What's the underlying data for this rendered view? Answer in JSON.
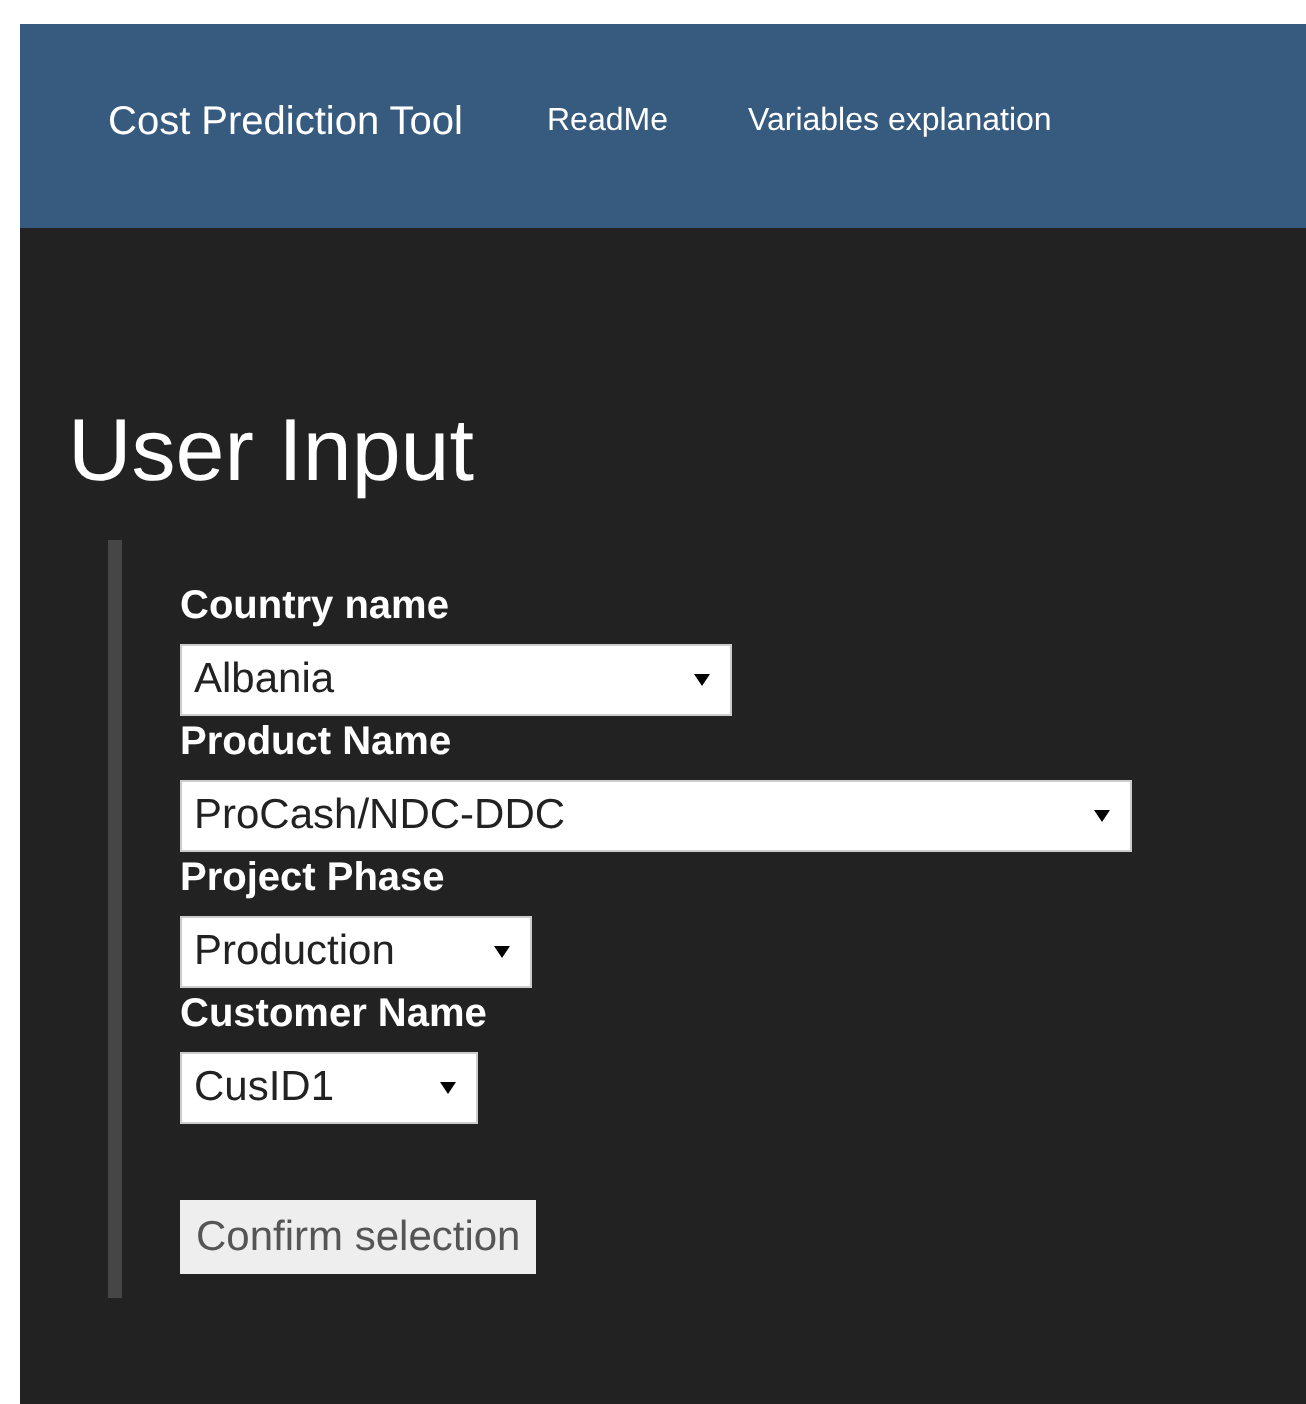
{
  "navbar": {
    "brand": "Cost Prediction Tool",
    "links": [
      {
        "label": "ReadMe"
      },
      {
        "label": "Variables explanation"
      }
    ]
  },
  "heading": "User Input",
  "fields": [
    {
      "label": "Country name",
      "value": "Albania"
    },
    {
      "label": "Product Name",
      "value": "ProCash/NDC-DDC"
    },
    {
      "label": "Project Phase",
      "value": "Production"
    },
    {
      "label": "Customer Name",
      "value": "CusID1"
    }
  ],
  "button": {
    "label": "Confirm selection"
  }
}
